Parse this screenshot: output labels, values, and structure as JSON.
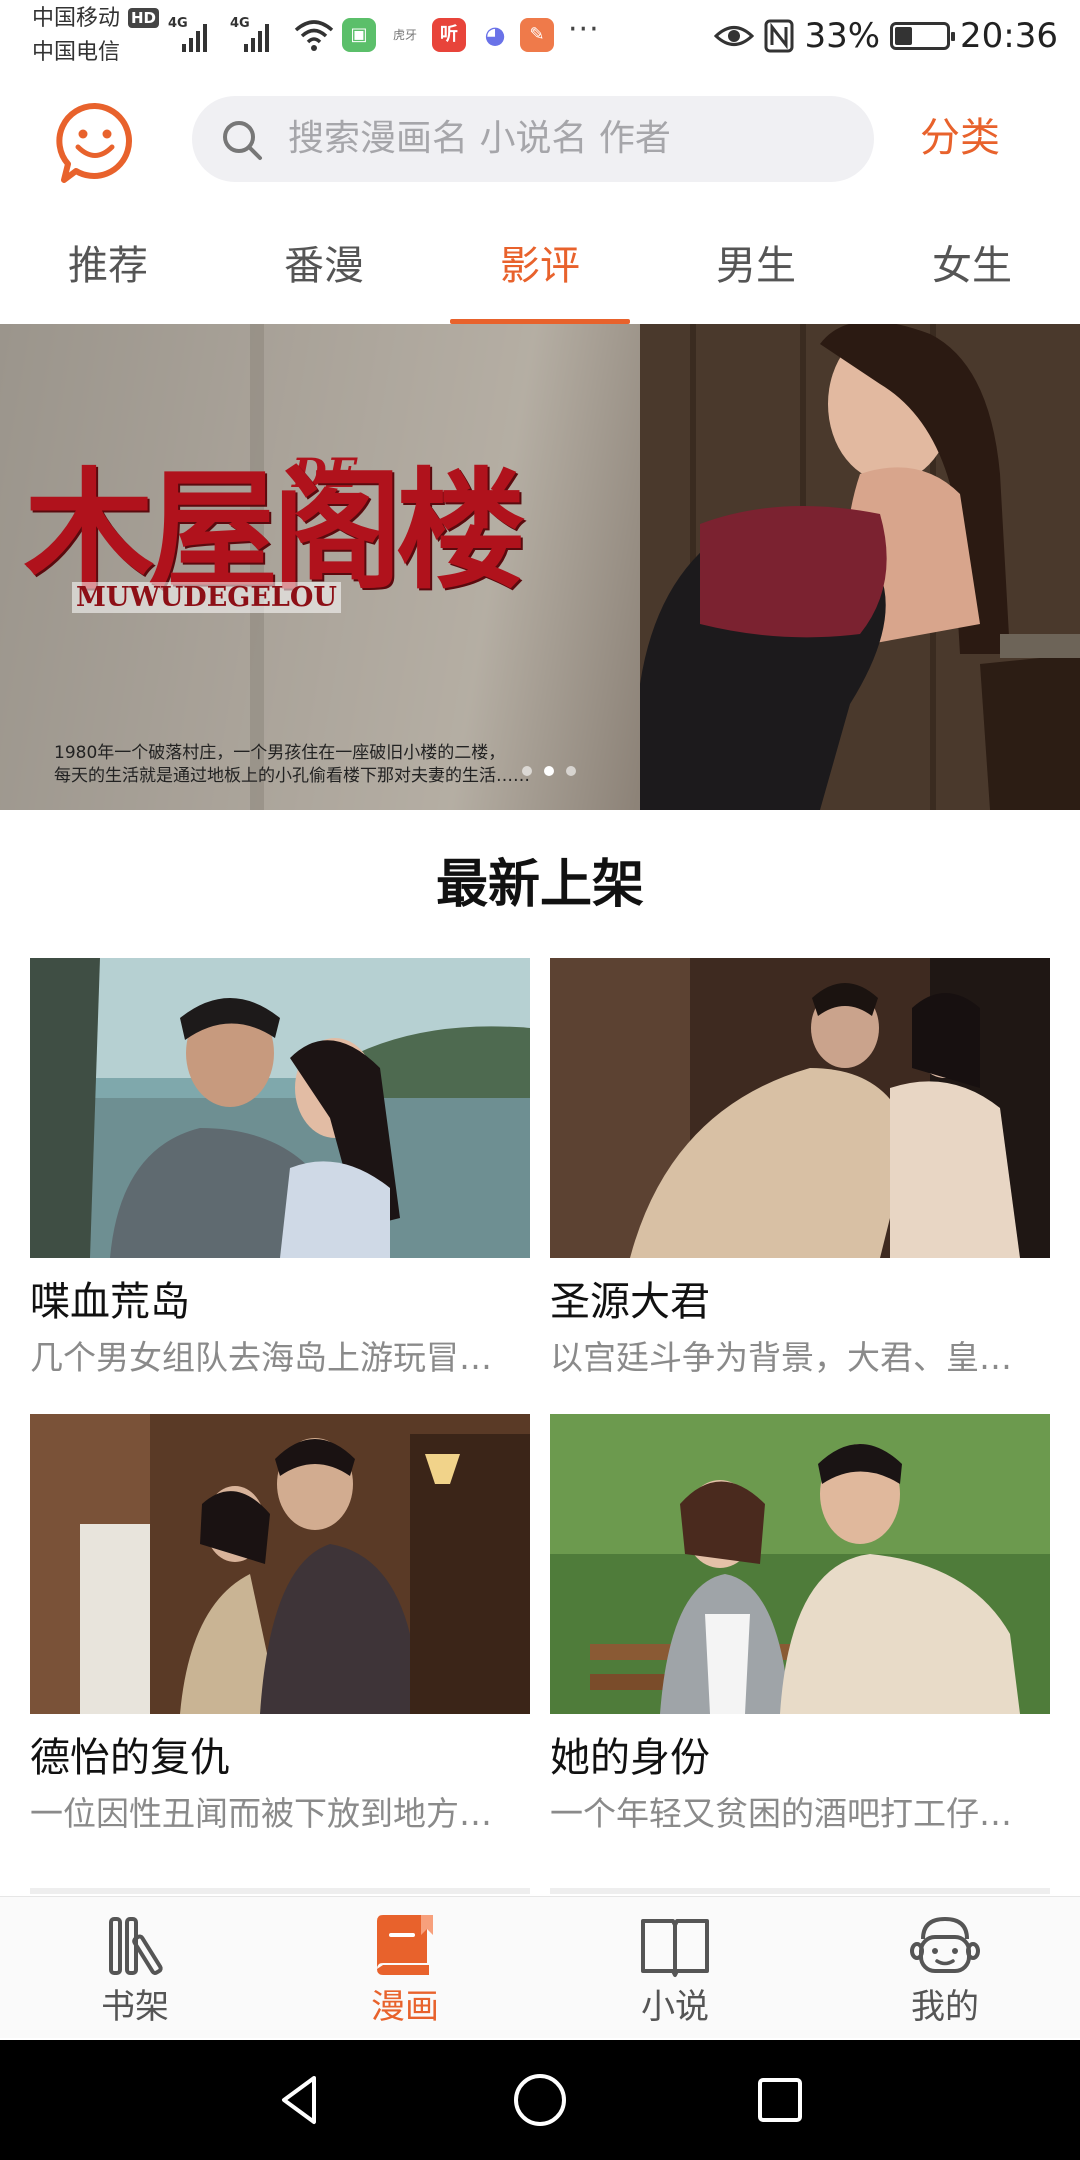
{
  "status_bar": {
    "carrier_primary": "中国移动",
    "carrier_secondary": "中国电信",
    "hd_badge": "HD",
    "network_1": "4G",
    "network_2": "4G",
    "app_icons": [
      "green-app-icon",
      "huya-app-icon",
      "ting-app-icon",
      "chat-app-icon",
      "orange-app-icon"
    ],
    "app_icon_labels": [
      "",
      "虎牙",
      "听",
      "",
      ""
    ],
    "overflow_dots": "···",
    "battery_percent": "33%",
    "battery_level": 0.33,
    "time": "20:36"
  },
  "header": {
    "logo_icon": "smiley-chat-logo",
    "search_placeholder": "搜索漫画名 小说名 作者",
    "category_label": "分类"
  },
  "tabs": [
    {
      "label": "推荐",
      "active": false
    },
    {
      "label": "番漫",
      "active": false
    },
    {
      "label": "影评",
      "active": true
    },
    {
      "label": "男生",
      "active": false
    },
    {
      "label": "女生",
      "active": false
    }
  ],
  "banner": {
    "title": "木屋阁楼",
    "title_small": "DE",
    "subtitle": "MUWUDEGELOU",
    "caption_line1": "1980年一个破落村庄，一个男孩住在一座破旧小楼的二楼，",
    "caption_line2": "每天的生活就是通过地板上的小孔偷看楼下那对夫妻的生活……",
    "slide_count": 3,
    "active_slide": 2
  },
  "section": {
    "heading": "最新上架"
  },
  "cards": [
    {
      "title": "喋血荒岛",
      "desc": "几个男女组队去海岛上游玩冒…"
    },
    {
      "title": "圣源大君",
      "desc": "以宫廷斗争为背景，大君、皇…"
    },
    {
      "title": "德怡的复仇",
      "desc": "一位因性丑闻而被下放到地方…"
    },
    {
      "title": "她的身份",
      "desc": "一个年轻又贫困的酒吧打工仔…"
    }
  ],
  "bottom_nav": [
    {
      "label": "书架",
      "icon": "bookshelf-icon",
      "active": false
    },
    {
      "label": "漫画",
      "icon": "comic-book-icon",
      "active": true
    },
    {
      "label": "小说",
      "icon": "open-book-icon",
      "active": false
    },
    {
      "label": "我的",
      "icon": "profile-face-icon",
      "active": false
    }
  ],
  "system_nav": [
    "back-icon",
    "home-icon",
    "recents-icon"
  ],
  "colors": {
    "accent": "#e8622c",
    "banner_title": "#b0121c"
  }
}
